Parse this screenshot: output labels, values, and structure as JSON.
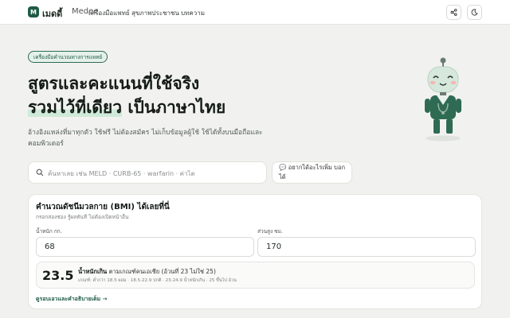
{
  "brand": {
    "logo_letter": "M",
    "name_th": "เมดดี้",
    "name_en": "Medee"
  },
  "nav": {
    "items": [
      "เครื่องมือแพทย์",
      "สุขภาพประชาชน",
      "บทความ"
    ]
  },
  "hero": {
    "badge": "เครื่องมือคำนวณทางการแพทย์",
    "title_line1": "สูตรและคะแนนที่ใช้จริง",
    "title_line2_a": "รวมไว้ที่เดียว",
    "title_line2_b": " เป็นภาษาไทย",
    "subtitle_line1": "อ้างอิงแหล่งที่มาทุกตัว ใช้ฟรี ไม่ต้องสมัคร ไม่เก็บข้อมูลผู้ใช้ ใช้ได้ทั้งบนมือถือและ",
    "subtitle_line2": "คอมพิวเตอร์"
  },
  "search": {
    "placeholder": "ค้นหาเลย เช่น MELD · CURB-65 · warfarin · ค่าไต",
    "suggest_label": "💬 อยากได้อะไรเพิ่ม บอกได้"
  },
  "bmi_card": {
    "title": "คำนวณดัชนีมวลกาย (BMI) ได้เลยที่นี่",
    "subtitle": "กรอกสองช่อง รู้ผลทันที ไม่ต้องเปิดหน้าอื่น",
    "weight_label": "น้ำหนัก กก.",
    "weight_value": "68",
    "height_label": "ส่วนสูง ซม.",
    "height_value": "170",
    "bmi_value": "23.5",
    "category": "น้ำหนักเกิน",
    "category_note": " ตามเกณฑ์คนเอเชีย (อ้วนที่ 23 ไม่ใช่ 25)",
    "criteria": "เกณฑ์: ต่ำกว่า 18.5 ผอม · 18.5-22.9 ปกติ · 23-24.9 น้ำหนักเกิน · 25 ขึ้นไป อ้วน",
    "details_link": "ดูรอบเอวและคำอธิบายเต็ม →"
  },
  "colors": {
    "brand": "#1f5b45",
    "background": "#f1f2ef",
    "highlight": "#cfead9"
  },
  "icons": [
    "share-icon",
    "moon-icon",
    "search-icon",
    "robot-mascot"
  ]
}
